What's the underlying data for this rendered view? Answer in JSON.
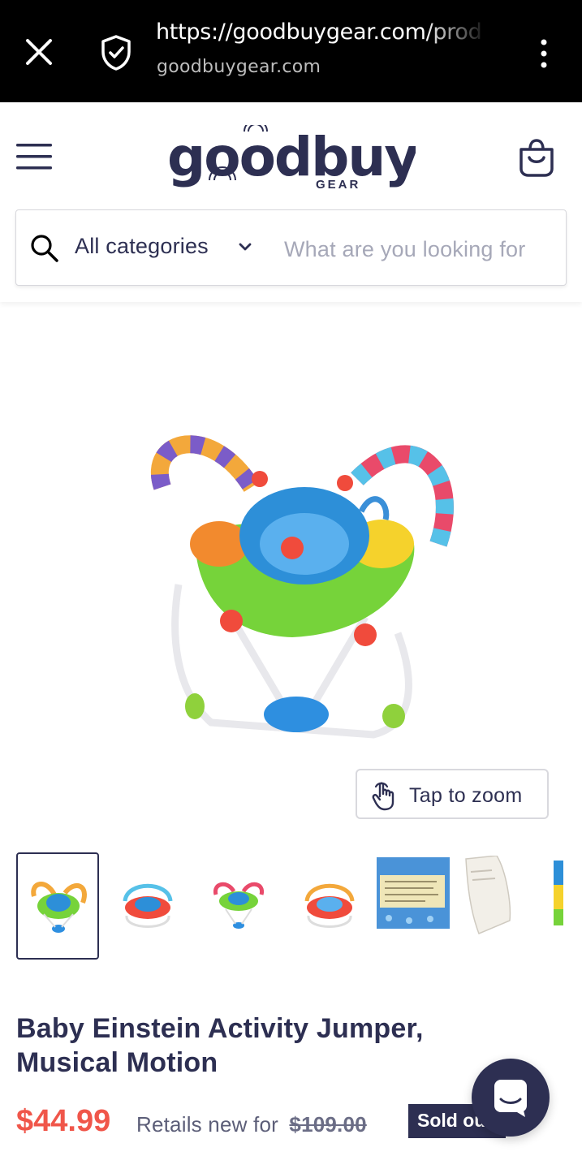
{
  "browser": {
    "url": "https://goodbuygear.com/prod",
    "domain": "goodbuygear.com",
    "icons": [
      "close-icon",
      "shield-check-icon",
      "more-vert-icon"
    ]
  },
  "header": {
    "logo_text": "goodbuy",
    "logo_subtext": "GEAR",
    "icons": [
      "hamburger-menu-icon",
      "shopping-bag-icon"
    ]
  },
  "search": {
    "category": "All categories",
    "placeholder": "What are you looking for"
  },
  "gallery": {
    "zoom_label": "Tap to zoom",
    "thumbnail_count": 7,
    "active_thumbnail": 1
  },
  "product": {
    "title": "Baby Einstein Activity Jumper, Musical Motion",
    "price": "$44.99",
    "retail_label": "Retails new for",
    "retail_price": "$109.00",
    "status": "Sold out"
  },
  "colors": {
    "brand_navy": "#2d2f52",
    "price_red": "#f0564a"
  }
}
